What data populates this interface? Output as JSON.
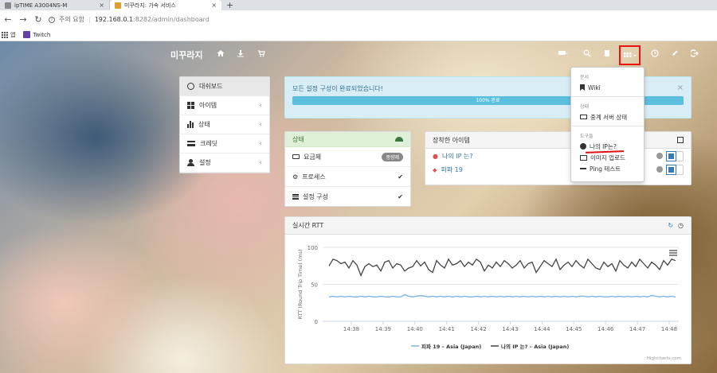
{
  "browser": {
    "tabs": [
      {
        "title": "ipTIME A3004NS-M",
        "active": false
      },
      {
        "title": "미꾸라지: 가속 서비스",
        "active": true
      }
    ],
    "new_tab": "+",
    "security_label": "주의 요함",
    "url_host": "192.168.0.1",
    "url_path": ":8282/admin/dashboard",
    "bookmarks": [
      "앱",
      "Twitch"
    ]
  },
  "navbar": {
    "brand": "미꾸라지"
  },
  "sidebar": {
    "items": [
      {
        "label": "대쉬보드",
        "icon": "dashboard-icon",
        "active": true
      },
      {
        "label": "아이템",
        "icon": "grid-icon"
      },
      {
        "label": "상태",
        "icon": "bar-chart-icon"
      },
      {
        "label": "크레딧",
        "icon": "card-icon"
      },
      {
        "label": "설정",
        "icon": "user-icon"
      }
    ]
  },
  "alert": {
    "message": "모든 설정 구성이 완료되었습니다!",
    "progress_label": "100% 완료",
    "progress": 100
  },
  "status_panel": {
    "title": "상태",
    "rows": [
      {
        "label": "요금제",
        "badge": "종량제"
      },
      {
        "label": "프로세스",
        "check": "✔"
      },
      {
        "label": "설정 구성",
        "check": "✔"
      }
    ]
  },
  "equipped_panel": {
    "title": "장착한 아이템",
    "items": [
      "나의 IP 는?",
      "피파 19"
    ]
  },
  "dropdown": {
    "sections": [
      {
        "header": "문서",
        "items": [
          "Wiki"
        ]
      },
      {
        "header": "상태",
        "items": [
          "중계 서버 상태"
        ]
      },
      {
        "header": "도구들",
        "items": [
          "나의 IP는?",
          "이미지 업로드",
          "Ping 테스트"
        ]
      }
    ]
  },
  "rtt_panel": {
    "title": "실시간 RTT",
    "credit": "Highcharts.com"
  },
  "chart_data": {
    "type": "line",
    "title": "",
    "ylabel": "RTT (Round Trip Time) (ms)",
    "xlabel": "",
    "ylim": [
      0,
      100
    ],
    "yticks": [
      0,
      50,
      100
    ],
    "x_tick_labels": [
      "14:38",
      "14:39",
      "14:40",
      "14:41",
      "14:42",
      "14:43",
      "14:44",
      "14:45",
      "14:46",
      "14:47",
      "14:48"
    ],
    "series": [
      {
        "name": "피파 19 – Asia (Japan)",
        "color": "#7cb5ec",
        "values": [
          33,
          34,
          33,
          34,
          33,
          34,
          33,
          33,
          34,
          33,
          34,
          33,
          33,
          34,
          33,
          33,
          34,
          33,
          33,
          36,
          34,
          33,
          34,
          35,
          34,
          33,
          34,
          33,
          34,
          33,
          34,
          33,
          34,
          33,
          34,
          33,
          33,
          34,
          33,
          34,
          33,
          34,
          33,
          34,
          33,
          34,
          33,
          34,
          33,
          34,
          33,
          34,
          33,
          34,
          33,
          34,
          33,
          34,
          33,
          34,
          33,
          34,
          33,
          34,
          34,
          33,
          34,
          33,
          34,
          33,
          33,
          34,
          33,
          34,
          33,
          34,
          33,
          34,
          33,
          34,
          33,
          35,
          34,
          33,
          34,
          33,
          34,
          33
        ]
      },
      {
        "name": "나의 IP 는? – Asia (Japan)",
        "color": "#434348",
        "values": [
          75,
          84,
          82,
          78,
          80,
          72,
          82,
          76,
          62,
          74,
          78,
          74,
          76,
          68,
          80,
          82,
          72,
          78,
          76,
          68,
          72,
          74,
          82,
          75,
          80,
          70,
          66,
          82,
          76,
          72,
          84,
          76,
          78,
          82,
          74,
          80,
          76,
          84,
          80,
          68,
          76,
          72,
          80,
          74,
          82,
          78,
          72,
          76,
          82,
          72,
          78,
          80,
          66,
          74,
          82,
          78,
          74,
          84,
          70,
          76,
          80,
          74,
          82,
          76,
          72,
          84,
          78,
          72,
          70,
          80,
          74,
          78,
          68,
          82,
          76,
          72,
          80,
          74,
          84,
          78,
          72,
          80,
          76,
          70,
          82,
          76,
          84,
          82
        ]
      }
    ],
    "legend": "bottom-center"
  }
}
